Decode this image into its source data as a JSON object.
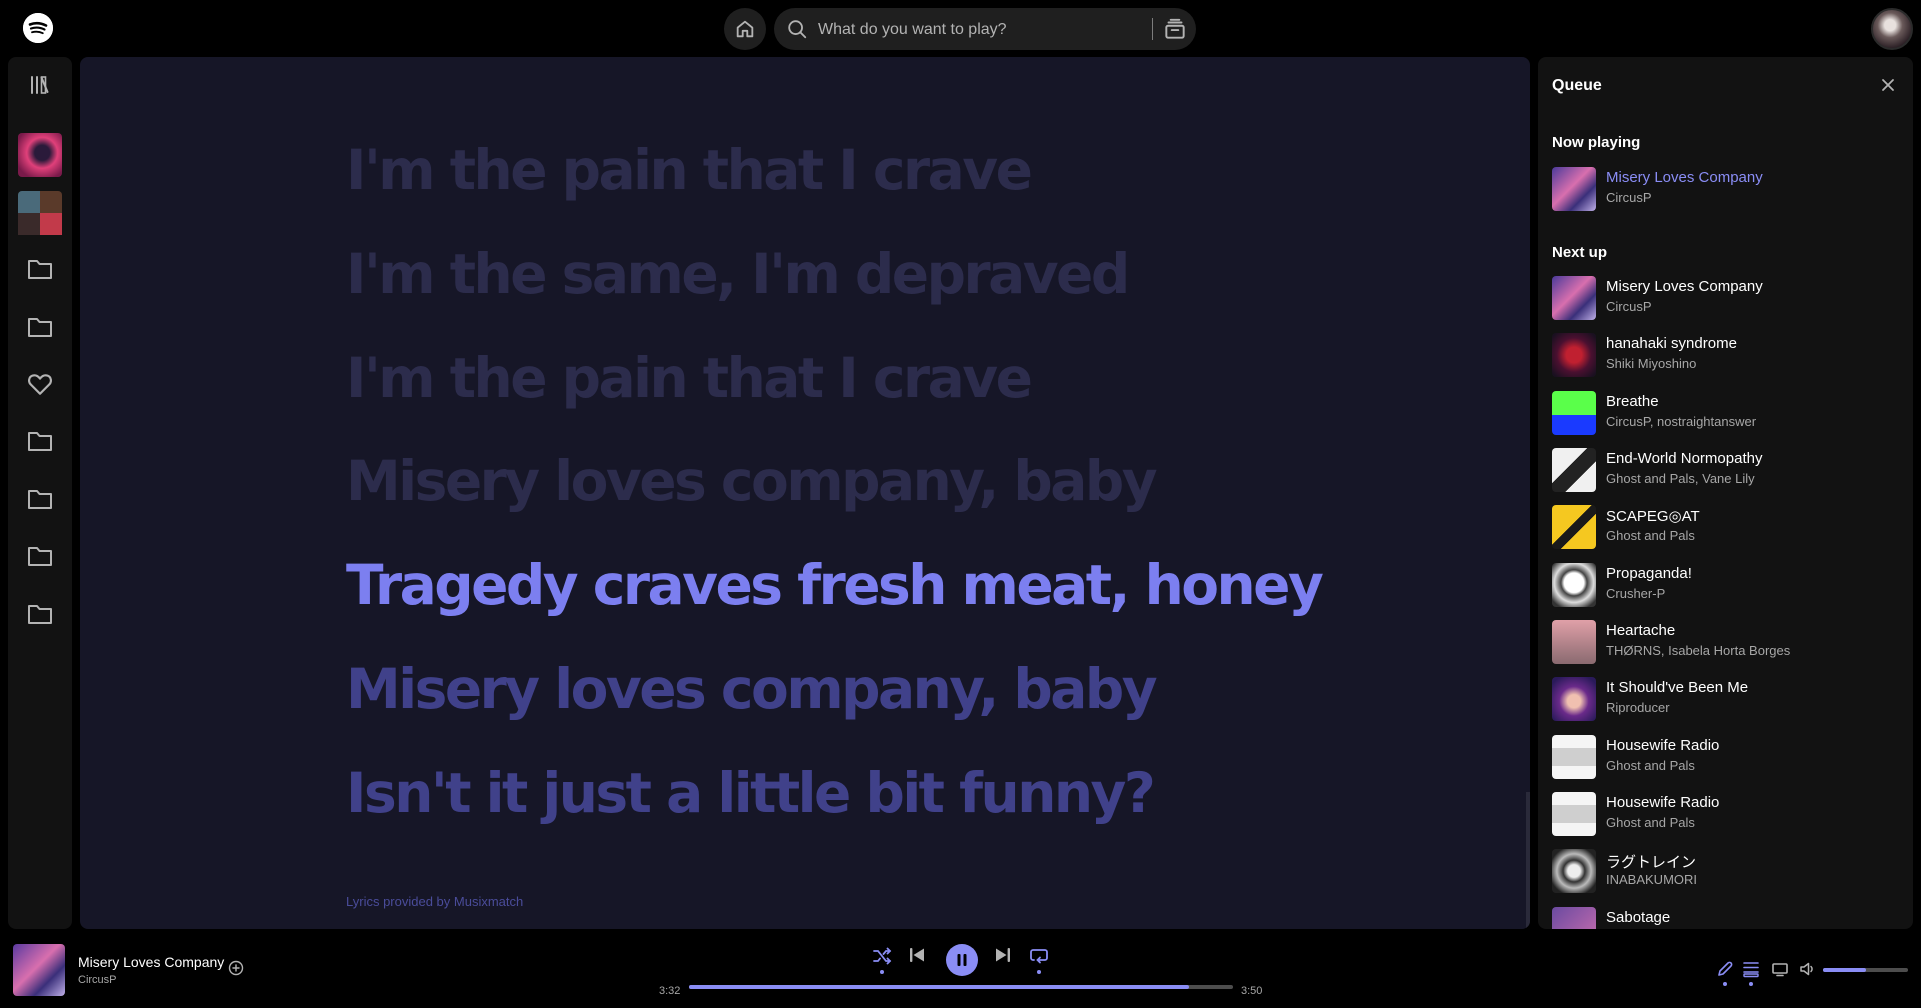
{
  "topbar": {
    "search_placeholder": "What do you want to play?"
  },
  "sidebar": {
    "items": [
      {
        "icon": "library-icon"
      },
      {
        "icon": "playlist-thumb-1"
      },
      {
        "icon": "playlist-thumb-2"
      },
      {
        "icon": "folder-icon"
      },
      {
        "icon": "folder-icon"
      },
      {
        "icon": "heart-icon"
      },
      {
        "icon": "folder-icon"
      },
      {
        "icon": "folder-icon"
      },
      {
        "icon": "folder-icon"
      },
      {
        "icon": "folder-icon"
      }
    ]
  },
  "lyrics": {
    "lines": [
      {
        "text": "I'm the pain that I crave",
        "state": "past"
      },
      {
        "text": "I'm the same, I'm depraved",
        "state": "past"
      },
      {
        "text": "I'm the pain that I crave",
        "state": "past"
      },
      {
        "text": "Misery loves company, baby",
        "state": "past"
      },
      {
        "text": "Tragedy craves fresh meat, honey",
        "state": "active"
      },
      {
        "text": "Misery loves company, baby",
        "state": "future"
      },
      {
        "text": "Isn't it just a little bit funny?",
        "state": "future"
      }
    ],
    "credit": "Lyrics provided by Musixmatch"
  },
  "queue": {
    "title": "Queue",
    "now_playing_label": "Now playing",
    "now_playing": {
      "name": "Misery Loves Company",
      "artist": "CircusP"
    },
    "next_up_label": "Next up",
    "items": [
      {
        "name": "Misery Loves Company",
        "artist": "CircusP"
      },
      {
        "name": "hanahaki syndrome",
        "artist": "Shiki Miyoshino"
      },
      {
        "name": "Breathe",
        "artist": "CircusP, nostraightanswer"
      },
      {
        "name": "End-World Normopathy",
        "artist": "Ghost and Pals, Vane Lily"
      },
      {
        "name": "SCAPEG◎AT",
        "artist": "Ghost and Pals"
      },
      {
        "name": "Propaganda!",
        "artist": "Crusher-P"
      },
      {
        "name": "Heartache",
        "artist": "THØRNS, Isabela Horta Borges"
      },
      {
        "name": "It Should've Been Me",
        "artist": "Riproducer"
      },
      {
        "name": "Housewife Radio",
        "artist": "Ghost and Pals"
      },
      {
        "name": "Housewife Radio",
        "artist": "Ghost and Pals"
      },
      {
        "name": "ラグトレイン",
        "artist": "INABAKUMORI"
      },
      {
        "name": "Sabotage",
        "artist": ""
      }
    ]
  },
  "player": {
    "title": "Misery Loves Company",
    "artist": "CircusP",
    "elapsed": "3:32",
    "duration": "3:50",
    "progress_fraction": 0.92,
    "volume_fraction": 0.5
  },
  "colors": {
    "accent": "#8a8df5",
    "lyrics_bg": "#161627"
  }
}
